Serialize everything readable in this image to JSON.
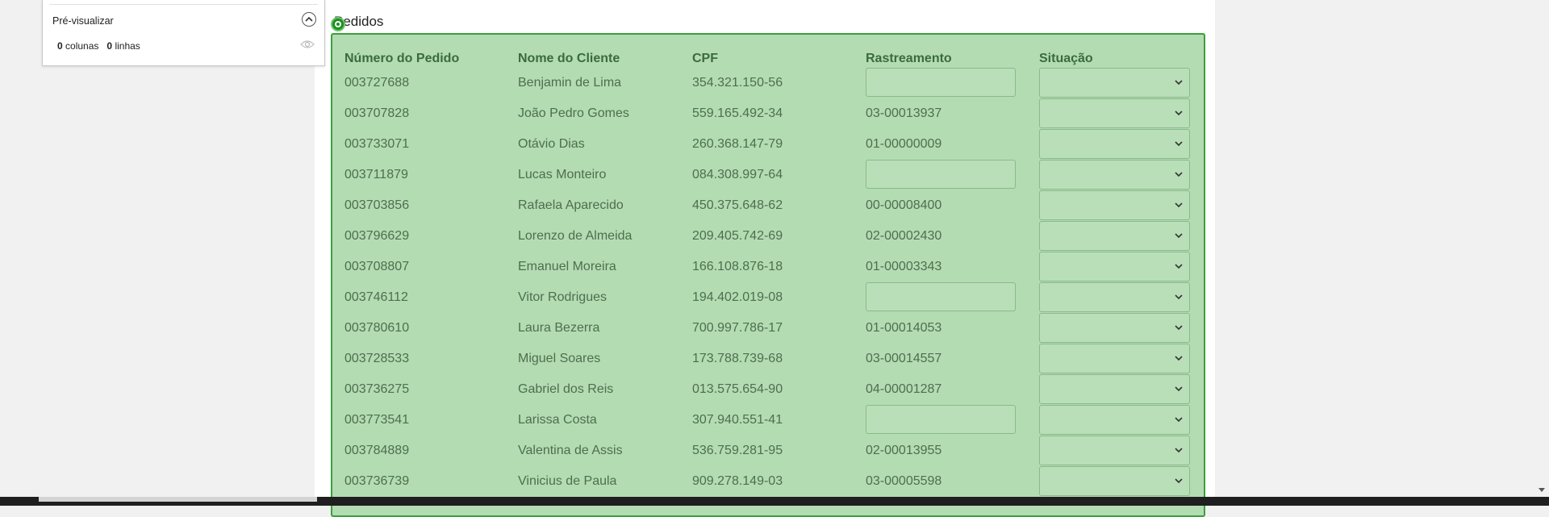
{
  "preview": {
    "title": "Pré-visualizar",
    "columns_count": "0",
    "columns_label": "colunas",
    "rows_count": "0",
    "rows_label": "linhas"
  },
  "section": {
    "title": "Pedidos"
  },
  "table": {
    "headers": [
      "Número do Pedido",
      "Nome do Cliente",
      "CPF",
      "Rastreamento",
      "Situação"
    ],
    "rows": [
      {
        "order": "003727688",
        "name": "Benjamin de Lima",
        "cpf": "354.321.150-56",
        "tracking": ""
      },
      {
        "order": "003707828",
        "name": "João Pedro Gomes",
        "cpf": "559.165.492-34",
        "tracking": "03-00013937"
      },
      {
        "order": "003733071",
        "name": "Otávio Dias",
        "cpf": "260.368.147-79",
        "tracking": "01-00000009"
      },
      {
        "order": "003711879",
        "name": "Lucas Monteiro",
        "cpf": "084.308.997-64",
        "tracking": ""
      },
      {
        "order": "003703856",
        "name": "Rafaela Aparecido",
        "cpf": "450.375.648-62",
        "tracking": "00-00008400"
      },
      {
        "order": "003796629",
        "name": "Lorenzo de Almeida",
        "cpf": "209.405.742-69",
        "tracking": "02-00002430"
      },
      {
        "order": "003708807",
        "name": "Emanuel Moreira",
        "cpf": "166.108.876-18",
        "tracking": "01-00003343"
      },
      {
        "order": "003746112",
        "name": "Vitor Rodrigues",
        "cpf": "194.402.019-08",
        "tracking": ""
      },
      {
        "order": "003780610",
        "name": "Laura Bezerra",
        "cpf": "700.997.786-17",
        "tracking": "01-00014053"
      },
      {
        "order": "003728533",
        "name": "Miguel Soares",
        "cpf": "173.788.739-68",
        "tracking": "03-00014557"
      },
      {
        "order": "003736275",
        "name": "Gabriel dos Reis",
        "cpf": "013.575.654-90",
        "tracking": "04-00001287"
      },
      {
        "order": "003773541",
        "name": "Larissa Costa",
        "cpf": "307.940.551-41",
        "tracking": ""
      },
      {
        "order": "003784889",
        "name": "Valentina de Assis",
        "cpf": "536.759.281-95",
        "tracking": "02-00013955"
      },
      {
        "order": "003736739",
        "name": "Vinicius de Paula",
        "cpf": "909.278.149-03",
        "tracking": "03-00005598"
      }
    ]
  },
  "colors": {
    "overlay_fill": "#b3dcb3",
    "overlay_border": "#3aa03a",
    "badge": "#1e8f1e"
  },
  "icons": [
    "collapse-up-icon",
    "eye-icon",
    "overlay-target-icon",
    "chevron-down-icon"
  ]
}
